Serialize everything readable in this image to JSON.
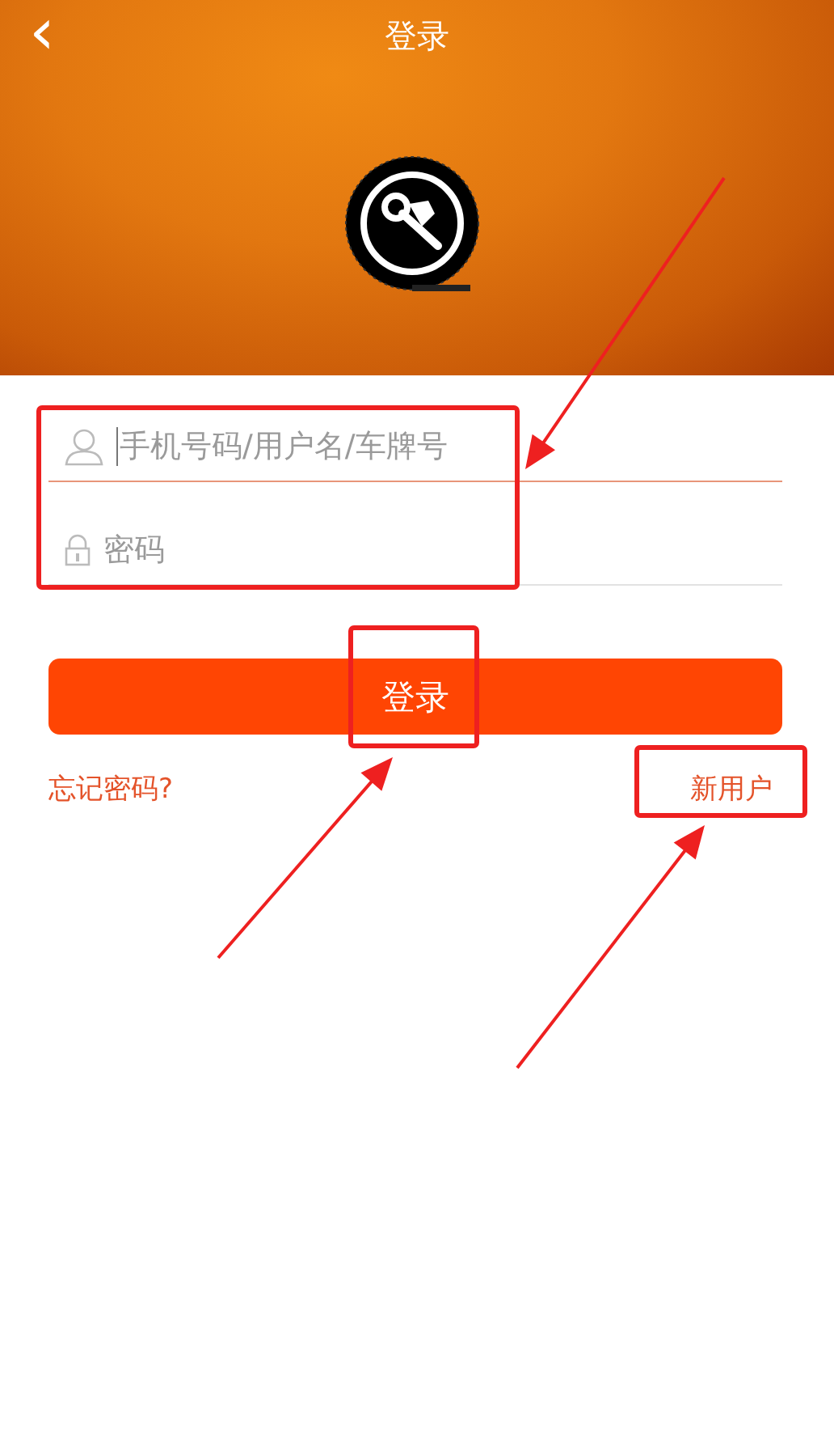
{
  "header": {
    "title": "登录",
    "back": "‹"
  },
  "fields": [
    {
      "kind": "user",
      "placeholder": "手机号码/用户名/车牌号",
      "focused": true
    },
    {
      "kind": "lock",
      "placeholder": "密码",
      "focused": false
    }
  ],
  "login_button": "登录",
  "links": [
    {
      "label": "忘记密码?"
    },
    {
      "label": "新用户"
    }
  ],
  "annotations": [
    {
      "kind": "box"
    },
    {
      "kind": "box"
    },
    {
      "kind": "box"
    },
    {
      "kind": "arrow"
    },
    {
      "kind": "arrow"
    },
    {
      "kind": "arrow"
    }
  ]
}
